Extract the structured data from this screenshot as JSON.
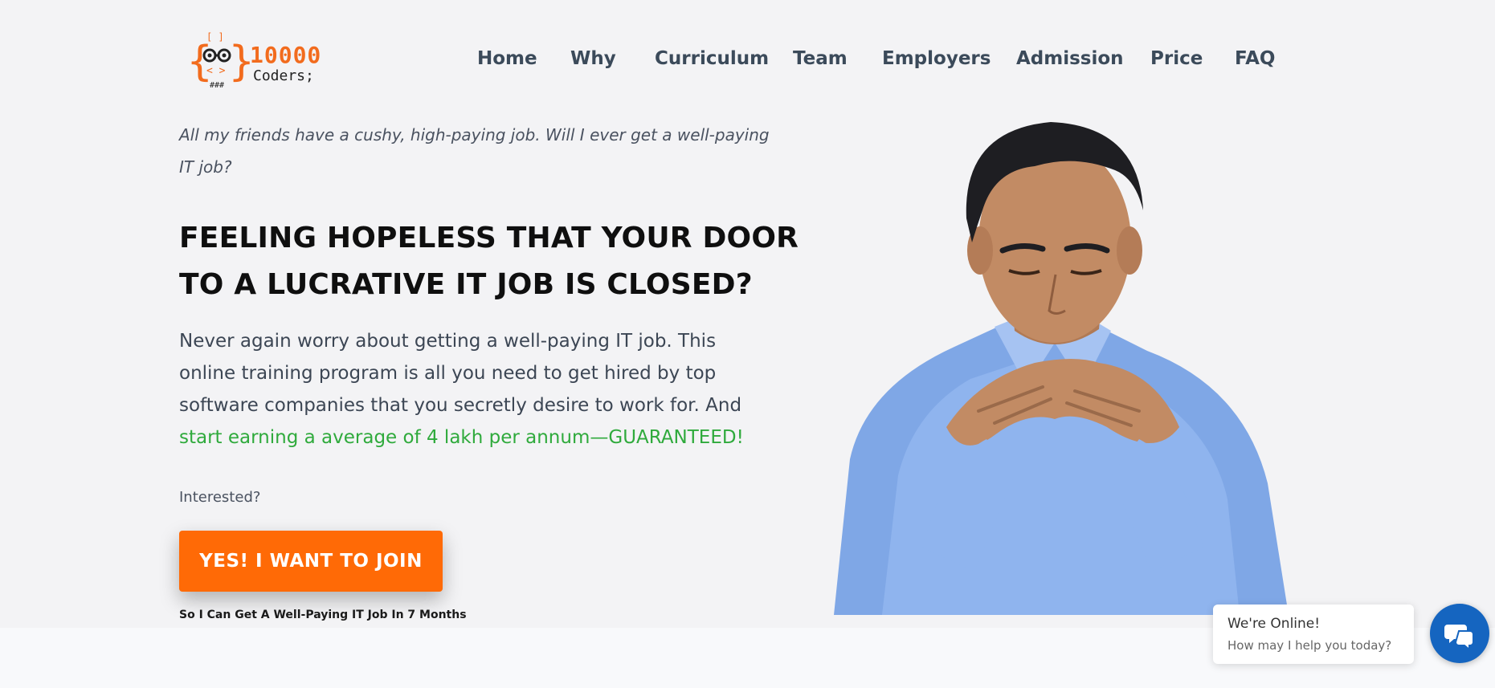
{
  "header": {
    "logo": {
      "number_text": "10000",
      "name_text": "Coders;"
    },
    "nav": [
      {
        "label": "Home"
      },
      {
        "label": "Why"
      },
      {
        "label": "Curriculum"
      },
      {
        "label": "Team"
      },
      {
        "label": "Employers"
      },
      {
        "label": "Admission"
      },
      {
        "label": "Price"
      },
      {
        "label": "FAQ"
      }
    ]
  },
  "hero": {
    "quote": "All my friends have a cushy, high-paying job. Will I ever get a well-paying IT job?",
    "headline": "FEELING HOPELESS THAT YOUR DOOR TO A LUCRATIVE IT JOB IS CLOSED?",
    "body_plain": "Never again worry about getting a well-paying IT job. This online training program is all you need to get hired by top software companies that you secretly desire to work for. And ",
    "body_highlight": "start earning a average of 4 lakh per annum—GUARANTEED!",
    "interested": "Interested?",
    "cta_label": "YES! I WANT TO JOIN",
    "cta_sub": "So I Can Get A Well-Paying IT Job In 7 Months",
    "highlight_color": "#2faa3c",
    "cta_color": "#ff6a06"
  },
  "chat": {
    "title": "We're Online!",
    "subtitle": "How may I help you today?",
    "icon": "chat-bubbles-icon",
    "color": "#1565c0"
  }
}
